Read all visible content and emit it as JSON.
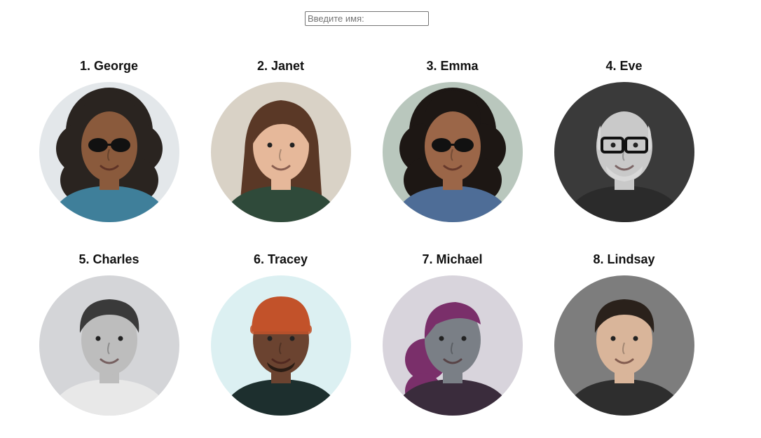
{
  "search": {
    "placeholder": "Введите имя:",
    "value": ""
  },
  "people": [
    {
      "label": "1. George",
      "bg": "#e3e7ea",
      "skin": "#8a5a3c",
      "hair": "#2a2420",
      "shirt": "#3f7f9a",
      "hair_style": "curly",
      "glasses": "sun"
    },
    {
      "label": "2. Janet",
      "bg": "#d9d2c6",
      "skin": "#e6b89a",
      "hair": "#5a3826",
      "shirt": "#2f4a3a",
      "hair_style": "long",
      "glasses": "none"
    },
    {
      "label": "3. Emma",
      "bg": "#b9c7bd",
      "skin": "#9b6648",
      "hair": "#1d1714",
      "shirt": "#4e6d97",
      "hair_style": "curly",
      "glasses": "sun"
    },
    {
      "label": "4. Eve",
      "bg": "#3a3a3a",
      "skin": "#c9c9c9",
      "hair": "#d8d8d8",
      "shirt": "#2b2b2b",
      "hair_style": "bald",
      "glasses": "frames"
    },
    {
      "label": "5. Charles",
      "bg": "#d4d5d8",
      "skin": "#bdbdbd",
      "hair": "#3a3a3a",
      "shirt": "#e8e8e8",
      "hair_style": "short",
      "glasses": "none"
    },
    {
      "label": "6. Tracey",
      "bg": "#dcf0f2",
      "skin": "#6b4330",
      "hair": "#c2522a",
      "shirt": "#1d2f2e",
      "hair_style": "beanie",
      "glasses": "none"
    },
    {
      "label": "7. Michael",
      "bg": "#d8d4dc",
      "skin": "#7a7f86",
      "hair": "#7a2f6a",
      "shirt": "#3a2c3c",
      "hair_style": "bun",
      "glasses": "none"
    },
    {
      "label": "8. Lindsay",
      "bg": "#7d7d7d",
      "skin": "#d9b59a",
      "hair": "#2a211b",
      "shirt": "#2e2e2e",
      "hair_style": "short",
      "glasses": "none"
    }
  ]
}
